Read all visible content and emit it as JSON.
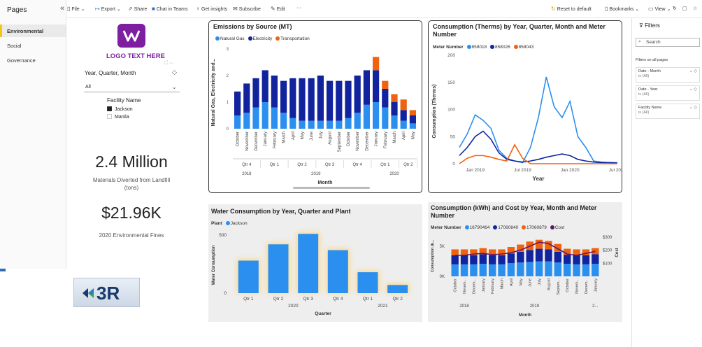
{
  "pages_pane": {
    "title": "Pages",
    "items": [
      {
        "label": "Environmental",
        "active": true
      },
      {
        "label": "Social",
        "active": false
      },
      {
        "label": "Governance",
        "active": false
      }
    ]
  },
  "toolbar": {
    "file": "File",
    "export": "Export",
    "share": "Share",
    "chat": "Chat in Teams",
    "insights": "Get insights",
    "subscribe": "Subscribe",
    "edit": "Edit",
    "more": "···",
    "reset": "Reset to default",
    "bookmarks": "Bookmarks",
    "view": "View"
  },
  "logo_text": "LOGO TEXT HERE",
  "slicer": {
    "title": "Year, Quarter, Month",
    "value": "All",
    "facility_title": "Facility Name",
    "facilities": [
      {
        "name": "Jackson",
        "checked": true
      },
      {
        "name": "Manila",
        "checked": false
      }
    ]
  },
  "kpis": [
    {
      "value": "2.4 Million",
      "label": "Materials Diverted from Landfill (tons)"
    },
    {
      "value": "$21.96K",
      "label": "2020 Environmental Fines"
    }
  ],
  "logo3r": "3R",
  "colors": {
    "natural_gas": "#2b8ff0",
    "electricity": "#12239e",
    "transportation": "#f0620e",
    "accent_yellow": "#f2c811",
    "cost": "#5a1a6a"
  },
  "emissions": {
    "title": "Emissions by Source (MT)",
    "legend": [
      "Natural Gas",
      "Electricity",
      "Transportation"
    ],
    "ylabel": "Natural Gas, Electricity and...",
    "xlabel": "Month",
    "months": [
      "October",
      "November",
      "December",
      "January",
      "February",
      "March",
      "April",
      "May",
      "June",
      "July",
      "August",
      "September",
      "October",
      "November",
      "December",
      "January",
      "February",
      "March",
      "April",
      "May"
    ],
    "quarters": [
      "Qtr 4",
      "Qtr 1",
      "Qtr 2",
      "Qtr 3",
      "Qtr 4",
      "Qtr 1",
      "Qtr 2"
    ],
    "years": [
      "2018",
      "2019",
      "2020"
    ],
    "yticks": [
      "0",
      "1",
      "2",
      "3"
    ]
  },
  "therms": {
    "title": "Consumption (Therms) by Year, Quarter, Month and Meter Number",
    "legend_title": "Meter Number",
    "legend": [
      "858018",
      "858026",
      "858043"
    ],
    "ylabel": "Consumption (Therms)",
    "xlabel": "Year",
    "yticks": [
      "0",
      "50",
      "100",
      "150",
      "200"
    ],
    "xticks": [
      "Jan 2019",
      "Jul 2019",
      "Jan 2020",
      "Jul 2020"
    ]
  },
  "water": {
    "title": "Water Consumption by Year, Quarter and Plant",
    "legend_title": "Plant",
    "legend": [
      "Jackson"
    ],
    "ylabel": "Water Consumption",
    "xlabel": "Quarter",
    "categories": [
      "Qtr 1",
      "Qtr 2",
      "Qtr 3",
      "Qtr 4",
      "Qtr 1",
      "Qtr 2"
    ],
    "years": [
      "2020",
      "2021"
    ],
    "yticks": [
      "0",
      "500"
    ]
  },
  "kwh": {
    "title": "Consumption (kWh) and Cost by Year, Month and Meter Number",
    "legend_title": "Meter Number",
    "legend": [
      "16790464",
      "17060840",
      "17060879",
      "Cost"
    ],
    "ylabel": "Consumption (k...",
    "ylabel_right": "Cost",
    "xlabel": "Month",
    "months": [
      "October",
      "Novem...",
      "Decem...",
      "January",
      "February",
      "March",
      "April",
      "May",
      "June",
      "July",
      "August",
      "Septem...",
      "October",
      "Novem...",
      "Decem...",
      "January"
    ],
    "years": [
      "2018",
      "2019",
      "2..."
    ],
    "yticks": [
      "0K",
      "5K"
    ],
    "yticks_right": [
      "$100",
      "$200",
      "$300"
    ]
  },
  "filters": {
    "title": "Filters",
    "search": "Search",
    "all_pages": "Filters on all pages",
    "cards": [
      {
        "name": "Date - Month",
        "value": "is (All)"
      },
      {
        "name": "Date - Year",
        "value": "is (All)"
      },
      {
        "name": "Facility Name",
        "value": "is (All)"
      }
    ]
  },
  "chart_data": [
    {
      "type": "bar",
      "title": "Emissions by Source (MT)",
      "categories": [
        "October 2018",
        "November 2018",
        "December 2018",
        "January 2019",
        "February 2019",
        "March 2019",
        "April 2019",
        "May 2019",
        "June 2019",
        "July 2019",
        "August 2019",
        "September 2019",
        "October 2019",
        "November 2019",
        "December 2019",
        "January 2020",
        "February 2020",
        "March 2020",
        "April 2020",
        "May 2020"
      ],
      "series": [
        {
          "name": "Natural Gas",
          "values": [
            0.5,
            0.6,
            0.8,
            1.0,
            0.8,
            0.6,
            0.4,
            0.3,
            0.3,
            0.3,
            0.3,
            0.3,
            0.4,
            0.6,
            0.9,
            1.0,
            0.8,
            0.5,
            0.3,
            0.2
          ]
        },
        {
          "name": "Electricity",
          "values": [
            0.9,
            1.1,
            1.1,
            1.2,
            1.2,
            1.2,
            1.5,
            1.6,
            1.6,
            1.7,
            1.5,
            1.5,
            1.4,
            1.4,
            1.3,
            1.2,
            0.7,
            0.5,
            0.4,
            0.3
          ]
        },
        {
          "name": "Transportation",
          "values": [
            0,
            0,
            0,
            0,
            0,
            0,
            0,
            0,
            0,
            0,
            0,
            0,
            0,
            0,
            0,
            0.5,
            0.3,
            0.3,
            0.4,
            0.2
          ]
        }
      ],
      "xlabel": "Month",
      "ylabel": "Natural Gas, Electricity and...",
      "ylim": [
        0,
        3
      ],
      "legend": "top"
    },
    {
      "type": "line",
      "title": "Consumption (Therms) by Year, Quarter, Month and Meter Number",
      "x": [
        "2018-11",
        "2018-12",
        "2019-01",
        "2019-02",
        "2019-03",
        "2019-04",
        "2019-05",
        "2019-06",
        "2019-07",
        "2019-08",
        "2019-09",
        "2019-10",
        "2019-11",
        "2019-12",
        "2020-01",
        "2020-02",
        "2020-03",
        "2020-04",
        "2020-05",
        "2020-06",
        "2020-07"
      ],
      "series": [
        {
          "name": "858018",
          "values": [
            30,
            55,
            90,
            80,
            65,
            25,
            10,
            5,
            2,
            30,
            85,
            160,
            105,
            85,
            115,
            50,
            30,
            5,
            3,
            2,
            2
          ]
        },
        {
          "name": "858026",
          "values": [
            15,
            30,
            50,
            60,
            45,
            20,
            8,
            5,
            3,
            5,
            8,
            12,
            15,
            18,
            15,
            8,
            5,
            3,
            2,
            2,
            1
          ]
        },
        {
          "name": "858043",
          "values": [
            0,
            10,
            15,
            15,
            12,
            8,
            5,
            35,
            10,
            0,
            0,
            0,
            0,
            0,
            0,
            0,
            0,
            0,
            0,
            0,
            0
          ]
        }
      ],
      "xlabel": "Year",
      "ylabel": "Consumption (Therms)",
      "ylim": [
        0,
        200
      ],
      "legend": "top"
    },
    {
      "type": "bar",
      "title": "Water Consumption by Year, Quarter and Plant",
      "categories": [
        "2020 Qtr 1",
        "2020 Qtr 2",
        "2020 Qtr 3",
        "2020 Qtr 4",
        "2021 Qtr 1",
        "2021 Qtr 2"
      ],
      "series": [
        {
          "name": "Jackson",
          "values": [
            280,
            420,
            510,
            370,
            180,
            70
          ]
        }
      ],
      "xlabel": "Quarter",
      "ylabel": "Water Consumption",
      "ylim": [
        0,
        560
      ],
      "legend": "top"
    },
    {
      "type": "bar",
      "title": "Consumption (kWh) and Cost by Year, Month and Meter Number",
      "categories": [
        "October 2018",
        "November 2018",
        "December 2018",
        "January 2019",
        "February 2019",
        "March 2019",
        "April 2019",
        "May 2019",
        "June 2019",
        "July 2019",
        "August 2019",
        "September 2019",
        "October 2019",
        "November 2019",
        "December 2019",
        "January 2020"
      ],
      "series": [
        {
          "name": "16790464",
          "values": [
            2.0,
            2.0,
            2.0,
            2.1,
            2.0,
            2.0,
            2.2,
            2.3,
            2.4,
            2.5,
            2.5,
            2.3,
            2.1,
            2.0,
            2.0,
            2.1
          ]
        },
        {
          "name": "17060840",
          "values": [
            1.5,
            1.5,
            1.5,
            1.6,
            1.5,
            1.5,
            1.6,
            1.8,
            2.0,
            2.1,
            2.0,
            1.8,
            1.5,
            1.5,
            1.5,
            1.6
          ]
        },
        {
          "name": "17060879",
          "values": [
            1.0,
            1.0,
            1.0,
            1.0,
            1.0,
            1.0,
            1.1,
            1.2,
            1.4,
            1.5,
            1.4,
            1.3,
            1.0,
            1.0,
            1.0,
            1.0
          ]
        },
        {
          "name": "Cost",
          "values": [
            160,
            160,
            170,
            175,
            165,
            170,
            180,
            200,
            230,
            260,
            250,
            210,
            170,
            160,
            175,
            190
          ]
        }
      ],
      "xlabel": "Month",
      "ylabel": "Consumption (k...",
      "ylim": [
        0,
        7
      ],
      "y2lim": [
        0,
        320
      ],
      "legend": "top"
    }
  ]
}
